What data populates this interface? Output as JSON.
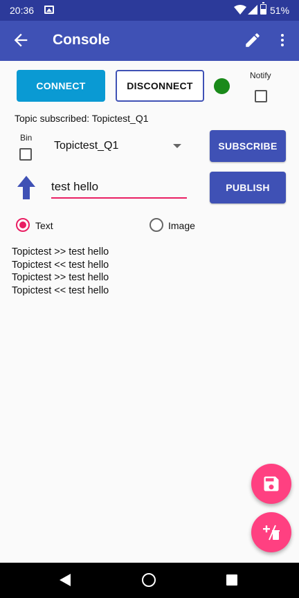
{
  "status_bar": {
    "time": "20:36",
    "battery_percent": "51%",
    "icons": [
      "image-icon",
      "wifi-icon",
      "cellular-icon",
      "battery-icon"
    ]
  },
  "app_bar": {
    "title": "Console",
    "back_icon": "arrow-back-icon",
    "edit_icon": "pencil-icon",
    "menu_icon": "more-vert-icon"
  },
  "connection": {
    "connect_label": "CONNECT",
    "disconnect_label": "DISCONNECT",
    "status_color": "#1a8a1a",
    "notify_label": "Notify",
    "notify_checked": false
  },
  "subscription": {
    "status_text": "Topic subscribed: Topictest_Q1",
    "bin_label": "Bin",
    "bin_checked": false,
    "topic_selected": "Topictest_Q1",
    "subscribe_label": "SUBSCRIBE"
  },
  "publish": {
    "message_value": "test hello",
    "publish_label": "PUBLISH",
    "publish_icon": "arrow-up-icon"
  },
  "format": {
    "text_label": "Text",
    "image_label": "Image",
    "selected": "Text"
  },
  "log": [
    "Topictest >> test hello",
    "Topictest << test hello",
    "Topictest >> test hello",
    "Topictest << test hello"
  ],
  "fabs": {
    "save_icon": "save-icon",
    "clear_icon": "clear-delete-icon"
  },
  "colors": {
    "primary": "#3f51b5",
    "status_bar": "#2c3a9a",
    "connect": "#0a9ad3",
    "accent": "#ff4081"
  }
}
